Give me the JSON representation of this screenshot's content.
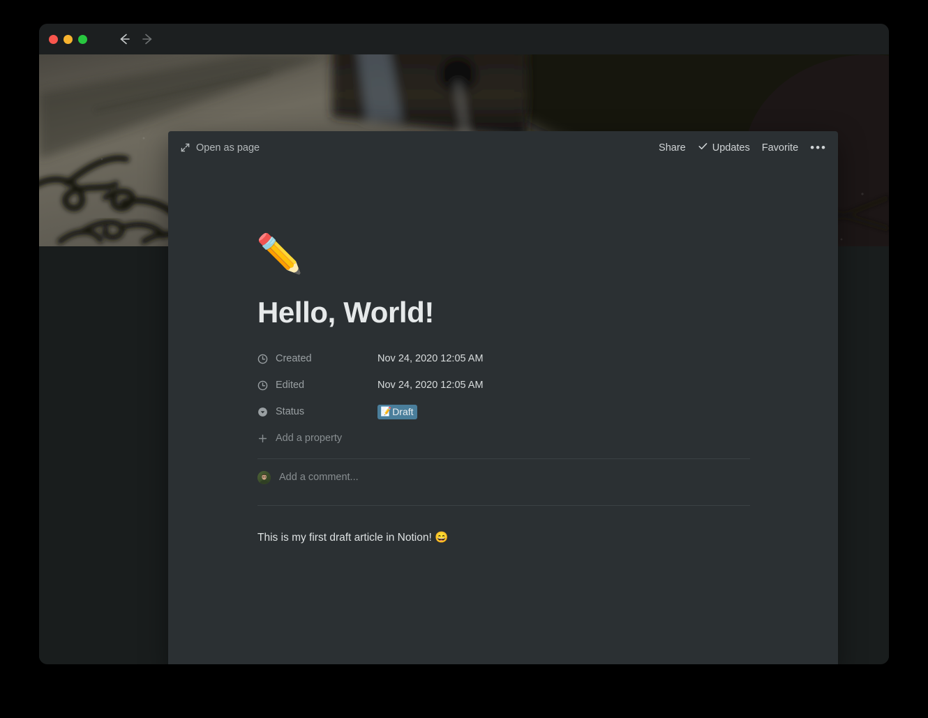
{
  "window": {
    "traffic_lights": [
      {
        "name": "close",
        "color": "#f9564d"
      },
      {
        "name": "minimize",
        "color": "#f7b32f"
      },
      {
        "name": "maximize",
        "color": "#28c73f"
      }
    ],
    "nav": {
      "back_label": "Back",
      "forward_label": "Forward"
    },
    "background": "#191d1d",
    "titlebar_background": "#1c1f20"
  },
  "cover": {
    "alt": "Blurred photo of dark handwriting scribbles on a light grey textured surface",
    "base_color": "#3b3a35"
  },
  "peek": {
    "background": "#2b3033",
    "topbar": {
      "open_as_page": "Open as page",
      "share": "Share",
      "updates": "Updates",
      "favorite": "Favorite",
      "more": "•••"
    },
    "emoji": "✏️",
    "title": "Hello, World!",
    "properties": [
      {
        "icon": "clock-icon",
        "label": "Created",
        "value": "Nov 24, 2020 12:05 AM",
        "type": "date"
      },
      {
        "icon": "clock-icon",
        "label": "Edited",
        "value": "Nov 24, 2020 12:05 AM",
        "type": "date"
      },
      {
        "icon": "select-icon",
        "label": "Status",
        "value": "Draft",
        "value_emoji": "📝",
        "type": "select",
        "chip_color": "#4a7e9b"
      }
    ],
    "add_property": "Add a property",
    "comment": {
      "placeholder": "Add a comment..."
    },
    "body_text": "This is my first draft article in Notion! 😄"
  },
  "colors": {
    "accent_chip": "#4a7e9b",
    "text_primary": "#e6e9ea",
    "text_secondary": "#9aa0a3",
    "divider": "#3b4144",
    "page_bg": "#191d1d",
    "panel_bg": "#2b3033"
  }
}
